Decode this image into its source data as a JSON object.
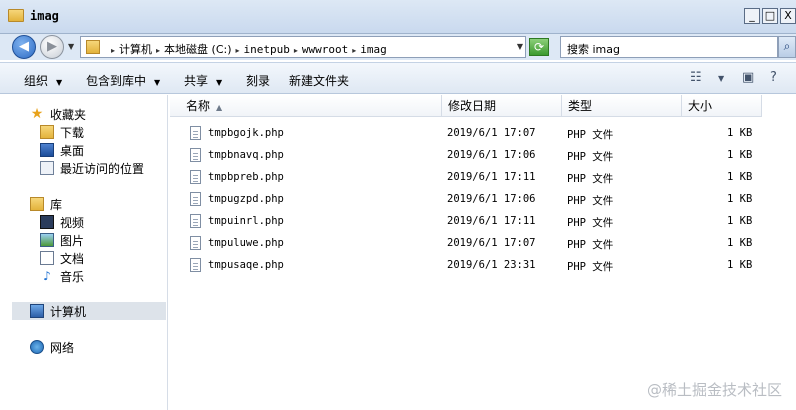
{
  "window": {
    "title": "imag",
    "minimize": "_",
    "maximize": "□",
    "close": "X"
  },
  "address": {
    "back": "◀",
    "forward": "▶",
    "crumbs": [
      "计算机",
      "本地磁盘 (C:)",
      "inetpub",
      "wwwroot",
      "imag"
    ],
    "search_placeholder": "搜索 imag"
  },
  "toolbar": {
    "organize": "组织",
    "include_in_library": "包含到库中",
    "share": "共享",
    "burn": "刻录",
    "new_folder": "新建文件夹"
  },
  "sidebar": {
    "favorites": {
      "label": "收藏夹",
      "items": [
        "下载",
        "桌面",
        "最近访问的位置"
      ]
    },
    "libraries": {
      "label": "库",
      "items": [
        "视频",
        "图片",
        "文档",
        "音乐"
      ]
    },
    "computer": "计算机",
    "network": "网络"
  },
  "columns": {
    "name": "名称",
    "date_modified": "修改日期",
    "type": "类型",
    "size": "大小"
  },
  "files": [
    {
      "name": "tmpbgojk.php",
      "date": "2019/6/1 17:07",
      "type": "PHP 文件",
      "size": "1 KB"
    },
    {
      "name": "tmpbnavq.php",
      "date": "2019/6/1 17:06",
      "type": "PHP 文件",
      "size": "1 KB"
    },
    {
      "name": "tmpbpreb.php",
      "date": "2019/6/1 17:11",
      "type": "PHP 文件",
      "size": "1 KB"
    },
    {
      "name": "tmpugzpd.php",
      "date": "2019/6/1 17:06",
      "type": "PHP 文件",
      "size": "1 KB"
    },
    {
      "name": "tmpuinrl.php",
      "date": "2019/6/1 17:11",
      "type": "PHP 文件",
      "size": "1 KB"
    },
    {
      "name": "tmpuluwe.php",
      "date": "2019/6/1 17:07",
      "type": "PHP 文件",
      "size": "1 KB"
    },
    {
      "name": "tmpusaqe.php",
      "date": "2019/6/1 23:31",
      "type": "PHP 文件",
      "size": "1 KB"
    }
  ],
  "watermark": "@稀土掘金技术社区"
}
